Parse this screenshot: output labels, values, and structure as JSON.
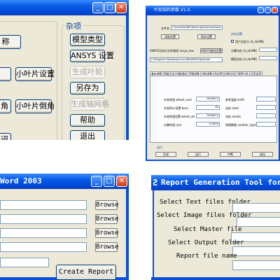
{
  "top_left": {
    "title_buttons": {
      "minimize": "_",
      "maximize": "□",
      "close": "✕"
    },
    "group_label": "杂项",
    "left_buttons": [
      "称",
      "小叶片设置",
      "角",
      "小叶片倒角",
      "迢"
    ],
    "right_buttons": [
      "模型类型",
      "ANSYS 设置",
      "生成叶轮",
      "另存为",
      "生成轴网格",
      "帮助",
      "退出"
    ],
    "disabled": [
      "生成叶轮",
      "生成轴网格"
    ]
  },
  "top_right": {
    "title": "叶轮结构参数 V1.0",
    "file_label": "文件名",
    "file_value": "F:\\test\\Test\\WF\\WorkingFolder\\test\\test.tp",
    "read_button": "读取设置",
    "save_button": "保存设置",
    "ansys_label": "ANSYS可执行文件路径 ansys_exe",
    "ansys_path_button": "ANSYS路径设置",
    "ansys_path_value": "C:\\Program Files\\Ansys Inc\\v80\\ANSYS\\bin\\intel",
    "inner_label": "内存设置",
    "checkbox_label": "用户自定义 (d_sb:MB)",
    "memory_label": "计算内存 (d_sb:MB)",
    "mode_label": "模型内存 (d_sb:MB)",
    "tabs": [
      "基本参数",
      "网格生成",
      "网格细化",
      "荷载参数",
      "材料参数",
      "热边界",
      "结构分析",
      "频率分析",
      "应用选项"
    ],
    "rows": [
      {
        "label": "叶轮转速 wheel_num",
        "value": "700000.0",
        "label2": "参考温度 tref0",
        "value2": ""
      },
      {
        "label": "叶轮Disc设置 bore",
        "value": "80",
        "label2": "泊松 elast",
        "value2": ""
      },
      {
        "label": "叶轮转速设置 wheel_de",
        "value": "700000.0",
        "label2": "泊松 xmatn",
        "value2": ""
      },
      {
        "label": "计算转速 rpm",
        "value": "114000",
        "label2": "网格数量 number_type",
        "value2": ""
      }
    ],
    "bottom_label": "运行",
    "bottom_buttons": [
      "生成",
      "运行",
      "中断",
      "退出"
    ]
  },
  "bottom_left": {
    "title": "Word 2003",
    "title_buttons": {
      "minimize": "_",
      "maximize": "□",
      "close": "✕"
    },
    "browse_label": "Browse",
    "create_label": "Create Report",
    "rows": 4
  },
  "bottom_right": {
    "title": "Report Generation Tool for Pow",
    "title_icon": "Ƨ",
    "labels": [
      "Select Text files folder",
      "Select Image files folder",
      "Select Master file",
      "Select Output folder",
      "Report file name"
    ]
  }
}
